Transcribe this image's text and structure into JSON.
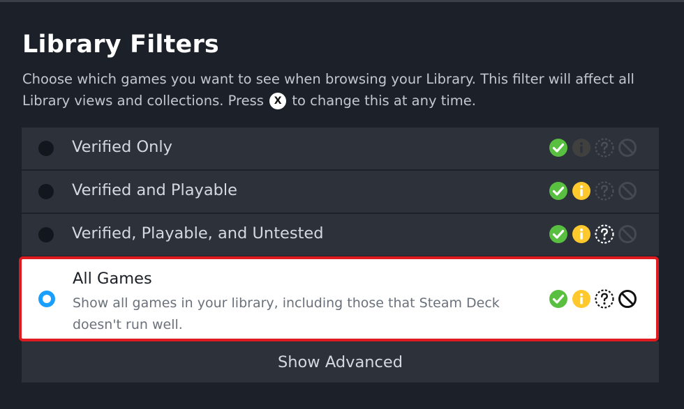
{
  "dialog": {
    "title": "Library Filters",
    "description_before": "Choose which games you want to see when browsing your Library. This filter will affect all Library views and collections. Press",
    "button_glyph": "X",
    "description_after": "to change this at any time."
  },
  "options": [
    {
      "label": "Verified Only",
      "selected": false,
      "icons": [
        "verified-icon",
        "playable-icon-dim",
        "untested-icon-dim",
        "unsupported-icon-dim"
      ]
    },
    {
      "label": "Verified and Playable",
      "selected": false,
      "icons": [
        "verified-icon",
        "playable-icon",
        "untested-icon-dim",
        "unsupported-icon-dim"
      ]
    },
    {
      "label": "Verified, Playable, and Untested",
      "selected": false,
      "icons": [
        "verified-icon",
        "playable-icon",
        "untested-icon",
        "unsupported-icon-dim"
      ]
    },
    {
      "label": "All Games",
      "selected": true,
      "sublabel": "Show all games in your library, including those that Steam Deck doesn't run well.",
      "icons": [
        "verified-icon",
        "playable-icon",
        "untested-icon",
        "unsupported-icon"
      ]
    }
  ],
  "show_advanced_label": "Show Advanced",
  "colors": {
    "background": "#1c2028",
    "row": "#2c313a",
    "verified": "#59bf40",
    "playable": "#ffc82c",
    "selected_border": "#e01b1f",
    "radio_selected": "#1a9fff"
  }
}
